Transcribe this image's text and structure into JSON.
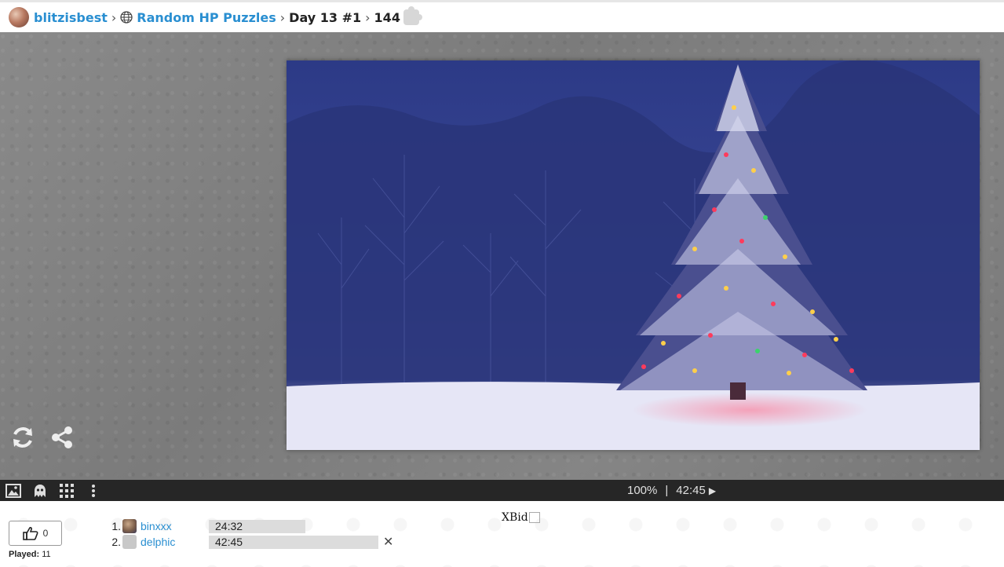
{
  "breadcrumb": {
    "user": "blitzisbest",
    "collection": "Random HP Puzzles",
    "puzzle": "Day 13 #1",
    "pieces": "144"
  },
  "icons": {
    "avatar": "user-avatar",
    "globe": "globe-icon",
    "piece": "puzzle-piece-icon",
    "rotate": "refresh-icon",
    "share": "share-icon",
    "image": "image-icon",
    "ghost": "ghost-icon",
    "grid": "grid-icon",
    "menu": "more-vertical-icon",
    "play": "play-icon",
    "like": "thumbs-up-icon",
    "close": "close-icon"
  },
  "status": {
    "progress": "100%",
    "separator": "|",
    "time": "42:45",
    "play_symbol": "▶"
  },
  "like": {
    "count": "0"
  },
  "played": {
    "label": "Played:",
    "count": "11"
  },
  "scores": [
    {
      "rank": "1.",
      "name": "binxxx",
      "time": "24:32",
      "bar_fraction": 0.57
    },
    {
      "rank": "2.",
      "name": "delphic",
      "time": "42:45",
      "bar_fraction": 1.0
    }
  ],
  "ad": {
    "text": "XBid"
  },
  "colors": {
    "link": "#2a8fd1",
    "toolbar": "#262626",
    "board": "#808080"
  }
}
